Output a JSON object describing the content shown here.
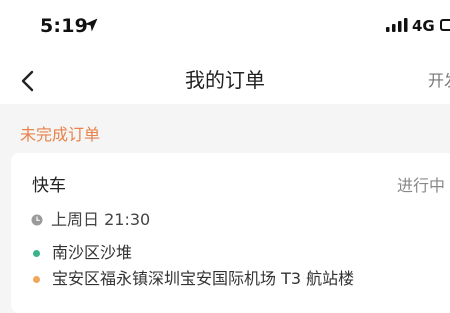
{
  "status_bar": {
    "time": "5:19",
    "network": "4G"
  },
  "nav": {
    "title": "我的订单",
    "right_action": "开发"
  },
  "section": {
    "label": "未完成订单"
  },
  "order": {
    "type": "快车",
    "status": "进行中",
    "time": "上周日 21:30",
    "start_address": "南沙区沙堆",
    "end_address": "宝安区福永镇深圳宝安国际机场 T3 航站楼"
  },
  "colors": {
    "accent": "#e8834a",
    "start_dot": "#3bb38a",
    "end_dot": "#f2a65a"
  },
  "icons": [
    "location-arrow-icon",
    "signal-icon",
    "battery-icon",
    "back-arrow-icon",
    "clock-icon"
  ]
}
